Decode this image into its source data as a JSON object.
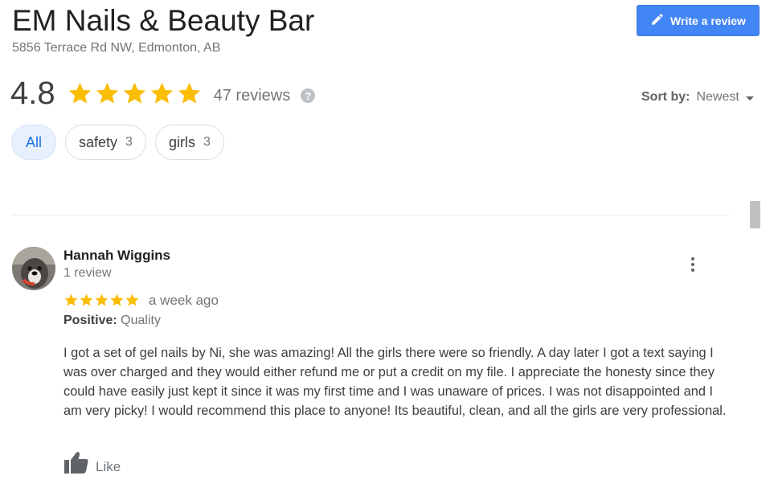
{
  "business": {
    "name": "EM Nails & Beauty Bar",
    "address": "5856 Terrace Rd NW, Edmonton, AB"
  },
  "write_review": {
    "label": "Write a review",
    "icon": "pencil-icon",
    "color": "#4285f4"
  },
  "summary": {
    "rating": "4.8",
    "star_rating": 4.8,
    "reviews_label": "47 reviews",
    "help_glyph": "?",
    "star_color": "#fbbc04"
  },
  "sort": {
    "label": "Sort by:",
    "value": "Newest"
  },
  "filters": [
    {
      "label": "All",
      "count": "",
      "selected": true
    },
    {
      "label": "safety",
      "count": "3",
      "selected": false
    },
    {
      "label": "girls",
      "count": "3",
      "selected": false
    }
  ],
  "review": {
    "name": "Hannah Wiggins",
    "reviewer_reviews": "1 review",
    "stars": 5,
    "time": "a week ago",
    "positive_label": "Positive:",
    "positive_value": "Quality",
    "text": "I got a set of gel nails by Ni, she was amazing! All the girls there were so friendly. A day later I got a text saying I was over charged and they would either refund me or put a credit on my file. I appreciate the honesty since they could have easily just kept it since it was my first time and I was unaware of prices. I was not disappointed and I am very picky! I would recommend this place to anyone! Its beautiful, clean, and all the girls are very professional.",
    "like_label": "Like"
  }
}
